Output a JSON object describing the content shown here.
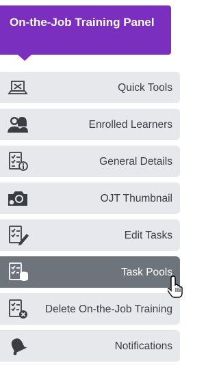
{
  "panel": {
    "title": "On-the-Job Training Panel"
  },
  "menu": {
    "items": [
      {
        "label": "Quick Tools",
        "icon": "quick-tools-icon",
        "active": false
      },
      {
        "label": "Enrolled Learners",
        "icon": "learners-icon",
        "active": false
      },
      {
        "label": "General Details",
        "icon": "details-icon",
        "active": false
      },
      {
        "label": "OJT Thumbnail",
        "icon": "camera-icon",
        "active": false
      },
      {
        "label": "Edit Tasks",
        "icon": "edit-tasks-icon",
        "active": false
      },
      {
        "label": "Task Pools",
        "icon": "task-pools-icon",
        "active": true
      },
      {
        "label": "Delete On-the-Job Training",
        "icon": "delete-icon",
        "active": false
      },
      {
        "label": "Notifications",
        "icon": "bell-icon",
        "active": false
      }
    ]
  },
  "colors": {
    "accent": "#7b2fbe",
    "item_bg": "#e6e8eb",
    "active_bg": "#6e747c",
    "text": "#3a3d42"
  }
}
